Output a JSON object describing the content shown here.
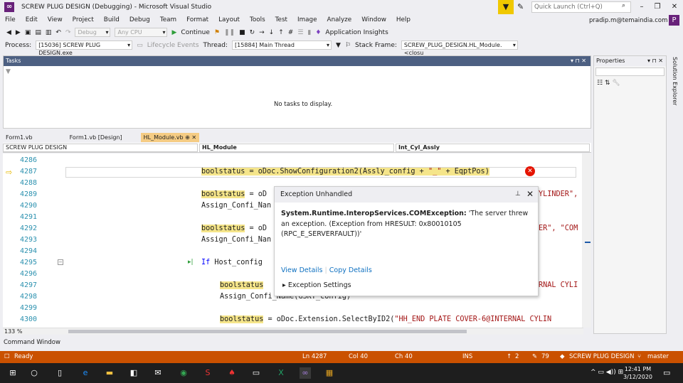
{
  "window": {
    "title": "SCREW PLUG DESIGN (Debugging) - Microsoft Visual Studio",
    "quick_launch_placeholder": "Quick Launch (Ctrl+Q)",
    "user": "pradip.m@temaindia.com",
    "avatar_letter": "P"
  },
  "menu": [
    "File",
    "Edit",
    "View",
    "Project",
    "Build",
    "Debug",
    "Team",
    "Format",
    "Layout",
    "Tools",
    "Test",
    "Image",
    "Analyze",
    "Window",
    "Help"
  ],
  "toolbar": {
    "config": "Debug",
    "platform": "Any CPU",
    "continue_label": "Continue",
    "app_insights": "Application Insights"
  },
  "debugbar": {
    "process_label": "Process:",
    "process_value": "[15036] SCREW PLUG DESIGN.exe",
    "lifecycle_label": "Lifecycle Events",
    "thread_label": "Thread:",
    "thread_value": "[15884] Main Thread",
    "stackframe_label": "Stack Frame:",
    "stackframe_value": "SCREW_PLUG_DESIGN.HL_Module.<closu"
  },
  "tasks": {
    "title": "Tasks",
    "empty_text": "No tasks to display."
  },
  "properties": {
    "title": "Properties"
  },
  "solution_explorer": {
    "title": "Solution Explorer"
  },
  "doc_tabs": [
    "Form1.vb",
    "Form1.vb [Design]",
    "HL_Module.vb"
  ],
  "nav": {
    "project": "SCREW PLUG DESIGN",
    "module": "HL_Module",
    "member": "Int_Cyl_Assly"
  },
  "code": {
    "lines": [
      "4286",
      "4287",
      "4288",
      "4289",
      "4290",
      "4291",
      "4292",
      "4293",
      "4294",
      "4295",
      "4296",
      "4297",
      "4298",
      "4299",
      "4300"
    ],
    "l4287_a": "boolstatus",
    "l4287_b": " = oDoc.ShowConfiguration2(Assly_config + ",
    "l4287_s1": "\"_\"",
    "l4287_c": " + EqptPos)",
    "l4289_a": "boolstatus",
    "l4289_b": " = oD",
    "l4289_tail": "YLINDER\",",
    "l4290": "Assign_Confi_Nan",
    "l4292_a": "boolstatus",
    "l4292_b": " = oD",
    "l4292_tail": "ER\", \"COM",
    "l4293": "Assign_Confi_Nan",
    "l4295_kw": "If",
    "l4295_rest": " Host_config",
    "l4297_a": "boolstatus",
    "l4297_tail": "RNAL CYLI",
    "l4298": "Assign_Confi_Name(GSKT_config)",
    "l4300_a": "boolstatus",
    "l4300_b": " = oDoc.Extension.SelectByID2(",
    "l4300_s": "\"HH_END PLATE COVER-6@INTERNAL CYLIN"
  },
  "exception": {
    "title": "Exception Unhandled",
    "exception_type": "System.Runtime.InteropServices.COMException:",
    "message": " 'The server threw an exception. (Exception from HRESULT: 0x80010105 (RPC_E_SERVERFAULT))'",
    "view_details": "View Details",
    "copy_details": "Copy Details",
    "settings": "Exception Settings"
  },
  "editor": {
    "zoom": "133 %"
  },
  "command_window": "Command Window",
  "status": {
    "ready": "Ready",
    "line": "Ln 4287",
    "col": "Col 40",
    "ch": "Ch 40",
    "ins": "INS",
    "up": "2",
    "changes": "79",
    "repo": "SCREW PLUG DESIGN",
    "branch": "master"
  },
  "clock": {
    "time": "12:41 PM",
    "date": "3/12/2020"
  },
  "colors": {
    "statusbar": "#ca5100",
    "accent": "#68217a",
    "tasks_header": "#4d6082"
  }
}
